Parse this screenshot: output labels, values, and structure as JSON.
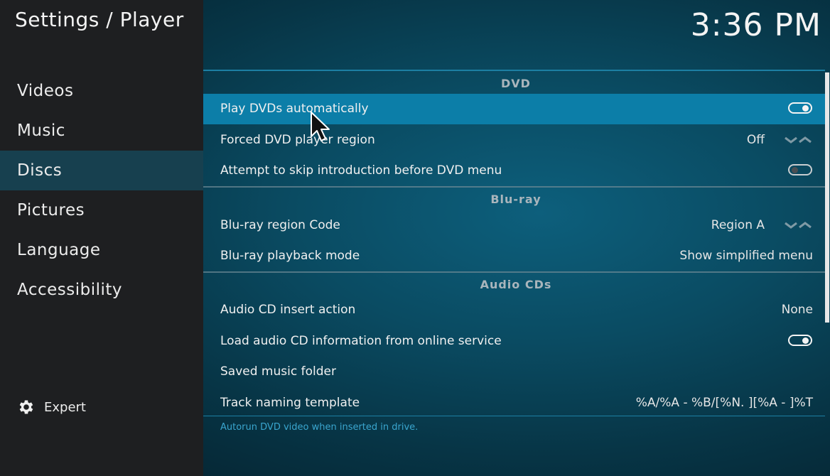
{
  "header": {
    "title": "Settings / Player",
    "clock": "3:36 PM"
  },
  "sidebar": {
    "items": [
      {
        "label": "Videos"
      },
      {
        "label": "Music"
      },
      {
        "label": "Discs",
        "selected": true
      },
      {
        "label": "Pictures"
      },
      {
        "label": "Language"
      },
      {
        "label": "Accessibility"
      }
    ],
    "level_label": "Expert",
    "level_icon": "gear-icon"
  },
  "sections": {
    "dvd": {
      "title": "DVD",
      "play_auto": {
        "label": "Play DVDs automatically",
        "toggle": "on"
      },
      "forced_region": {
        "label": "Forced DVD player region",
        "value": "Off"
      },
      "skip_intro": {
        "label": "Attempt to skip introduction before DVD menu",
        "toggle": "off"
      }
    },
    "bluray": {
      "title": "Blu-ray",
      "region_code": {
        "label": "Blu-ray region Code",
        "value": "Region A"
      },
      "playback_mode": {
        "label": "Blu-ray playback mode",
        "value": "Show simplified menu"
      }
    },
    "audiocd": {
      "title": "Audio CDs",
      "insert_action": {
        "label": "Audio CD insert action",
        "value": "None"
      },
      "load_info": {
        "label": "Load audio CD information from online service",
        "toggle": "on"
      },
      "saved_folder": {
        "label": "Saved music folder",
        "value": ""
      },
      "track_template": {
        "label": "Track naming template",
        "value": "%A/%A - %B/[%N. ][%A - ]%T"
      }
    }
  },
  "description": "Autorun DVD video when inserted in drive.",
  "colors": {
    "focus": "#0c7ea8",
    "sidebar_bg": "#1e1f21",
    "sidebar_selected": "#17404f",
    "description_text": "#3aa6cf"
  }
}
